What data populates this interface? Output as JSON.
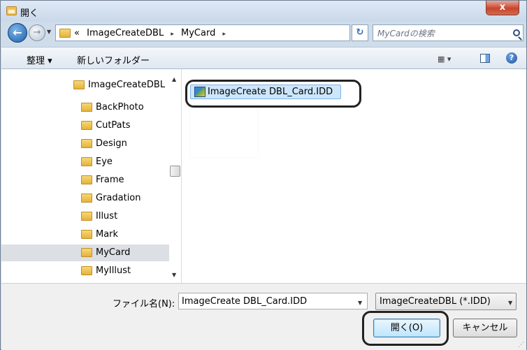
{
  "window": {
    "title": "開く",
    "close_label": "x"
  },
  "address": {
    "overflow": "«",
    "crumbs": [
      "ImageCreateDBL",
      "MyCard"
    ],
    "sep": "▸",
    "search_placeholder": "MyCardの検索"
  },
  "toolbar": {
    "organize": "整理 ▾",
    "new_folder": "新しいフォルダー",
    "view": "▦ ▾",
    "help": "?"
  },
  "nav": {
    "items": [
      {
        "label": "ImageCreateDBL"
      },
      {
        "label": "BackPhoto"
      },
      {
        "label": "CutPats"
      },
      {
        "label": "Design"
      },
      {
        "label": "Eye"
      },
      {
        "label": "Frame"
      },
      {
        "label": "Gradation"
      },
      {
        "label": "Illust"
      },
      {
        "label": "Mark"
      },
      {
        "label": "MyCard"
      },
      {
        "label": "MyIllust"
      }
    ],
    "selected": "MyCard"
  },
  "files": [
    {
      "name": "ImageCreate DBL_Card.IDD"
    }
  ],
  "footer": {
    "filename_label": "ファイル名(N):",
    "filename_value": "ImageCreate DBL_Card.IDD",
    "filetype_value": "ImageCreateDBL (*.IDD)",
    "open_label": "開く(O)",
    "cancel_label": "キャンセル"
  }
}
